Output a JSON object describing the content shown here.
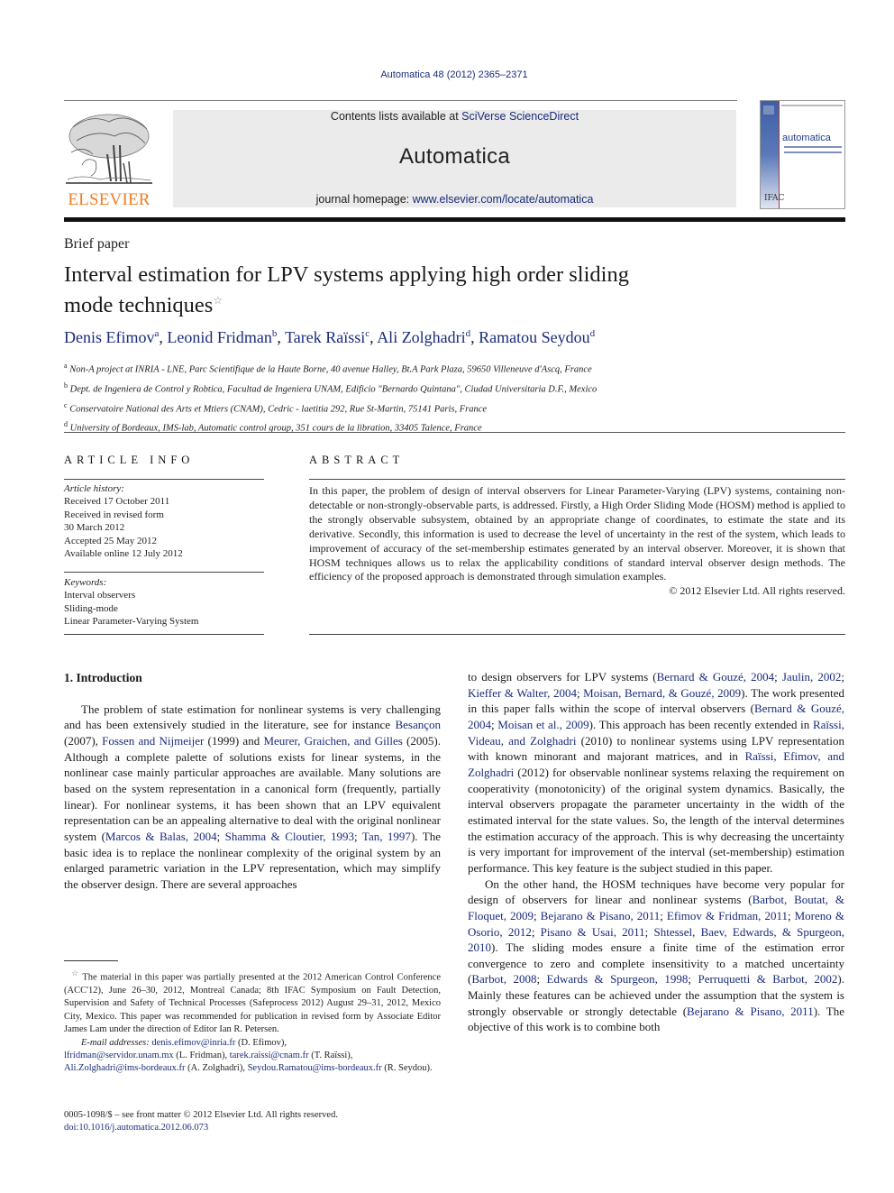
{
  "header": {
    "journal_ref": "Automatica 48 (2012) 2365–2371",
    "publisher_logo_text": "ELSEVIER",
    "contents_prefix": "Contents lists available at ",
    "contents_link": "SciVerse ScienceDirect",
    "journal_title": "Automatica",
    "homepage_prefix": "journal homepage: ",
    "homepage_link": "www.elsevier.com/locate/automatica",
    "cover_title": "automatica",
    "cover_seal": "IFAC"
  },
  "article": {
    "type": "Brief paper",
    "title_line1": "Interval estimation for LPV systems applying high order sliding",
    "title_line2": "mode techniques",
    "title_note_symbol": "☆",
    "authors": [
      {
        "name": "Denis Efimov",
        "aff": "a"
      },
      {
        "name": "Leonid Fridman",
        "aff": "b"
      },
      {
        "name": "Tarek Raïssi",
        "aff": "c"
      },
      {
        "name": "Ali Zolghadri",
        "aff": "d"
      },
      {
        "name": "Ramatou Seydou",
        "aff": "d"
      }
    ],
    "affiliations": [
      {
        "key": "a",
        "text": "Non-A project at INRIA - LNE, Parc Scientifique de la Haute Borne, 40 avenue Halley, Bt.A Park Plaza, 59650 Villeneuve d'Ascq, France"
      },
      {
        "key": "b",
        "text": "Dept. de Ingeniera de Control y Robtica, Facultad de Ingeniera UNAM, Edificio \"Bernardo Quintana\", Ciudad Universitaria D.F., Mexico"
      },
      {
        "key": "c",
        "text": "Conservatoire National des Arts et Mtiers (CNAM), Cedric - laetitia 292, Rue St-Martin, 75141 Paris, France"
      },
      {
        "key": "d",
        "text": "University of Bordeaux, IMS-lab, Automatic control group, 351 cours de la libration, 33405 Talence, France"
      }
    ]
  },
  "article_info": {
    "heading": "ARTICLE INFO",
    "history_label": "Article history:",
    "history": [
      "Received 17 October 2011",
      "Received in revised form",
      "30 March 2012",
      "Accepted 25 May 2012",
      "Available online 12 July 2012"
    ],
    "keywords_label": "Keywords:",
    "keywords": [
      "Interval observers",
      "Sliding-mode",
      "Linear Parameter-Varying System"
    ]
  },
  "abstract": {
    "heading": "ABSTRACT",
    "text": "In this paper, the problem of design of interval observers for Linear Parameter-Varying (LPV) systems, containing non-detectable or non-strongly-observable parts, is addressed. Firstly, a High Order Sliding Mode (HOSM) method is applied to the strongly observable subsystem, obtained by an appropriate change of coordinates, to estimate the state and its derivative. Secondly, this information is used to decrease the level of uncertainty in the rest of the system, which leads to improvement of accuracy of the set-membership estimates generated by an interval observer. Moreover, it is shown that HOSM techniques allows us to relax the applicability conditions of standard interval observer design methods. The efficiency of the proposed approach is demonstrated through simulation examples.",
    "copyright": "© 2012 Elsevier Ltd. All rights reserved."
  },
  "body": {
    "section_heading": "1.  Introduction",
    "left_para": [
      {
        "t": "The problem of state estimation for nonlinear systems is very challenging and has been extensively studied in the literature, see for instance "
      },
      {
        "t": "Besançon",
        "link": true
      },
      {
        "t": " (2007), "
      },
      {
        "t": "Fossen and Nijmeijer",
        "link": true
      },
      {
        "t": " (1999) and "
      },
      {
        "t": "Meurer, Graichen, and Gilles",
        "link": true
      },
      {
        "t": " (2005). Although a complete palette of solutions exists for linear systems, in the nonlinear case mainly particular approaches are available. Many solutions are based on the system representation in a canonical form (frequently, partially linear). For nonlinear systems, it has been shown that an LPV equivalent representation can be an appealing alternative to deal with the original nonlinear system ("
      },
      {
        "t": "Marcos & Balas, 2004",
        "link": true
      },
      {
        "t": "; "
      },
      {
        "t": "Shamma & Cloutier, 1993",
        "link": true
      },
      {
        "t": "; "
      },
      {
        "t": "Tan, 1997",
        "link": true
      },
      {
        "t": "). The basic idea is to replace the nonlinear complexity of the original system by an enlarged parametric variation in the LPV representation, which may simplify the observer design. There are several approaches"
      }
    ],
    "right_para1": [
      {
        "t": "to design observers for LPV systems ("
      },
      {
        "t": "Bernard & Gouzé, 2004",
        "link": true
      },
      {
        "t": "; "
      },
      {
        "t": "Jaulin, 2002",
        "link": true
      },
      {
        "t": "; "
      },
      {
        "t": "Kieffer & Walter, 2004",
        "link": true
      },
      {
        "t": "; "
      },
      {
        "t": "Moisan, Bernard, & Gouzé, 2009",
        "link": true
      },
      {
        "t": "). The work presented in this paper falls within the scope of interval observers ("
      },
      {
        "t": "Bernard & Gouzé, 2004",
        "link": true
      },
      {
        "t": "; "
      },
      {
        "t": "Moisan et al., 2009",
        "link": true
      },
      {
        "t": "). This approach has been recently extended in "
      },
      {
        "t": "Raïssi, Videau, and Zolghadri",
        "link": true
      },
      {
        "t": " (2010) to nonlinear systems using LPV representation with known minorant and majorant matrices, and in "
      },
      {
        "t": "Raïssi, Efimov, and Zolghadri",
        "link": true
      },
      {
        "t": " (2012) for observable nonlinear systems relaxing the requirement on cooperativity (monotonicity) of the original system dynamics. Basically, the interval observers propagate the parameter uncertainty in the width of the estimated interval for the state values. So, the length of the interval determines the estimation accuracy of the approach. This is why decreasing the uncertainty is very important for improvement of the interval (set-membership) estimation performance. This key feature is the subject studied in this paper."
      }
    ],
    "right_para2": [
      {
        "t": "On the other hand, the HOSM techniques have become very popular for design of observers for linear and nonlinear systems ("
      },
      {
        "t": "Barbot, Boutat, & Floquet, 2009",
        "link": true
      },
      {
        "t": "; "
      },
      {
        "t": "Bejarano & Pisano, 2011",
        "link": true
      },
      {
        "t": "; "
      },
      {
        "t": "Efimov & Fridman, 2011",
        "link": true
      },
      {
        "t": "; "
      },
      {
        "t": "Moreno & Osorio, 2012",
        "link": true
      },
      {
        "t": "; "
      },
      {
        "t": "Pisano & Usai, 2011",
        "link": true
      },
      {
        "t": "; "
      },
      {
        "t": "Shtessel, Baev, Edwards, & Spurgeon, 2010",
        "link": true
      },
      {
        "t": "). The sliding modes ensure a finite time of the estimation error convergence to zero and complete insensitivity to a matched uncertainty ("
      },
      {
        "t": "Barbot, 2008",
        "link": true
      },
      {
        "t": "; "
      },
      {
        "t": "Edwards & Spurgeon, 1998",
        "link": true
      },
      {
        "t": "; "
      },
      {
        "t": "Perruquetti & Barbot, 2002",
        "link": true
      },
      {
        "t": "). Mainly these features can be achieved under the assumption that the system is strongly observable or strongly detectable ("
      },
      {
        "t": "Bejarano & Pisano, 2011",
        "link": true
      },
      {
        "t": "). The objective of this work is to combine both"
      }
    ]
  },
  "footnote": {
    "symbol": "☆",
    "text": "The material in this paper was partially presented at the 2012 American Control Conference (ACC'12), June 26–30, 2012, Montreal Canada; 8th IFAC Symposium on Fault Detection, Supervision and Safety of Technical Processes (Safeprocess 2012) August 29–31, 2012, Mexico City, Mexico. This paper was recommended for publication in revised form by Associate Editor James Lam under the direction of Editor Ian R. Petersen.",
    "email_label": "E-mail addresses:",
    "emails": [
      {
        "email": "denis.efimov@inria.fr",
        "who": " (D. Efimov),"
      },
      {
        "email": "lfridman@servidor.unam.mx",
        "who": " (L. Fridman), "
      },
      {
        "email": "tarek.raissi@cnam.fr",
        "who": " (T. Raïssi),"
      },
      {
        "email": "Ali.Zolghadri@ims-bordeaux.fr",
        "who": " (A. Zolghadri), "
      },
      {
        "email": "Seydou.Ramatou@ims-bordeaux.fr",
        "who": " (R. Seydou)."
      }
    ]
  },
  "front_matter": {
    "issn_line": "0005-1098/$ – see front matter © 2012 Elsevier Ltd. All rights reserved.",
    "doi": "doi:10.1016/j.automatica.2012.06.073"
  },
  "colors": {
    "link": "#1a2b7a",
    "elsevier_orange": "#f07e26",
    "masthead_bg": "#ebebeb"
  }
}
